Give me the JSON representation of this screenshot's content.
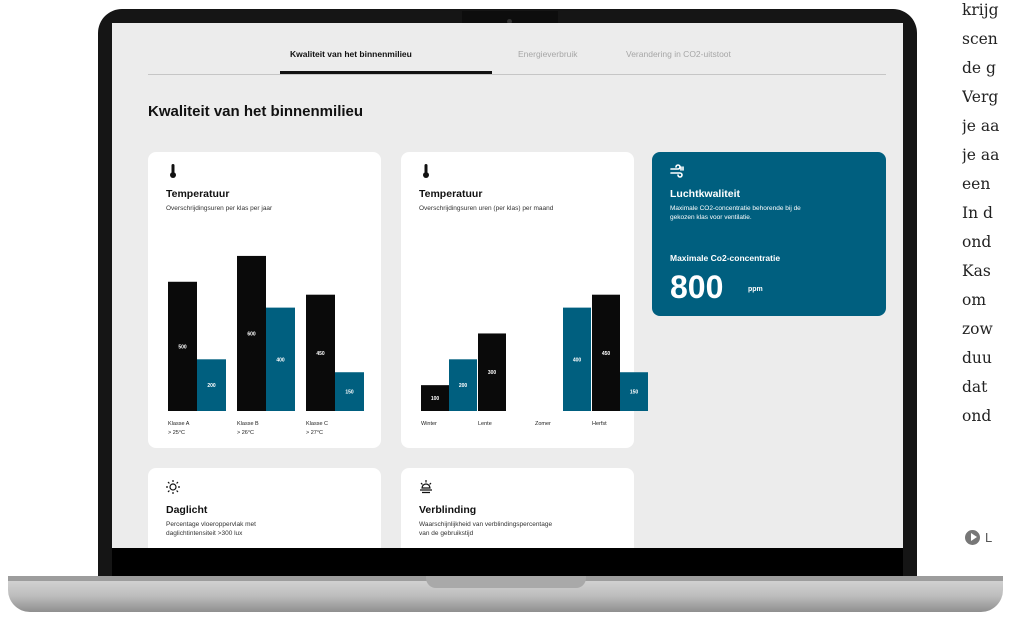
{
  "tabs": [
    {
      "label": "Kwaliteit van het binnenmilieu",
      "active": true
    },
    {
      "label": "Energieverbruik",
      "active": false
    },
    {
      "label": "Verandering in CO2-uitstoot",
      "active": false
    }
  ],
  "page_title": "Kwaliteit van het binnenmilieu",
  "cards": {
    "temperature_class": {
      "icon": "thermometer-icon",
      "title": "Temperatuur",
      "subtitle": "Overschrijdingsuren per klas per jaar"
    },
    "temperature_season": {
      "icon": "thermometer-icon",
      "title": "Temperatuur",
      "subtitle": "Overschrijdingsuren uren (per klas) per maand"
    },
    "air_quality": {
      "icon": "air-flow-icon",
      "title": "Luchtkwaliteit",
      "subtitle_line1": "Maximale CO2-concentratie behorende bij de",
      "subtitle_line2": "gekozen klas voor ventilatie.",
      "metric_label": "Maximale Co2-concentratie",
      "value": "800",
      "unit": "ppm",
      "background": "#005f7f"
    },
    "daylight": {
      "icon": "sun-icon",
      "title": "Daglicht",
      "subtitle_line1": "Percentage vloeroppervlak met",
      "subtitle_line2": "daglichtintensiteit >300 lux"
    },
    "glare": {
      "icon": "glare-sun-icon",
      "title": "Verblinding",
      "subtitle_line1": "Waarschijnlijkheid van verblindingspercentage",
      "subtitle_line2": "van de gebruikstijd"
    }
  },
  "chart_data": [
    {
      "type": "bar",
      "title": "Temperatuur",
      "subtitle": "Overschrijdingsuren per klas per jaar",
      "categories": [
        "Klasse A",
        "Klasse B",
        "Klasse C"
      ],
      "category_sublabels": [
        "> 25°C",
        "> 26°C",
        "> 27°C"
      ],
      "series": [
        {
          "color": "#0a0a0a",
          "values": [
            500,
            600,
            450
          ]
        },
        {
          "color": "#005f7f",
          "values": [
            200,
            400,
            150
          ]
        }
      ],
      "ylim": [
        0,
        650
      ]
    },
    {
      "type": "bar",
      "title": "Temperatuur",
      "subtitle": "Overschrijdingsuren uren (per klas) per maand",
      "categories": [
        "Winter",
        "Lente",
        "Zomer",
        "Herfst"
      ],
      "series": [
        {
          "color": "#0a0a0a",
          "values": [
            100,
            300,
            null,
            450
          ]
        },
        {
          "color": "#005f7f",
          "values": [
            200,
            null,
            400,
            150
          ]
        }
      ],
      "ylim": [
        0,
        650
      ]
    }
  ],
  "side_article": {
    "lines": [
      "krijg",
      "scen",
      "de g",
      "Verg",
      "je aa",
      "je aa",
      "een",
      "In d",
      "ond",
      "Kas",
      "om",
      "zow",
      "duu",
      "dat",
      "ond"
    ],
    "link_label": "L"
  }
}
